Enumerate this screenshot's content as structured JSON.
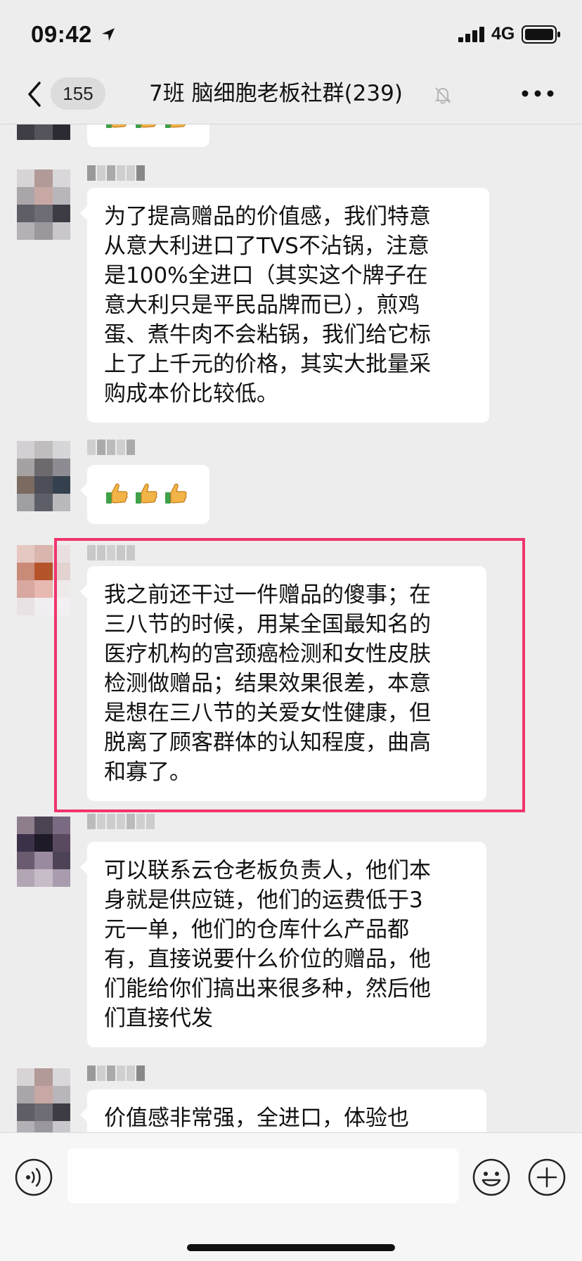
{
  "status_bar": {
    "time": "09:42",
    "network": "4G"
  },
  "nav": {
    "unread_count": "155",
    "title": "7班 脑细胞老板社群(239)"
  },
  "messages": [
    {
      "id": "m1",
      "type": "emoji",
      "emoji": [
        "thumbs-up",
        "thumbs-up",
        "thumbs-up"
      ]
    },
    {
      "id": "m2",
      "type": "text",
      "lines": [
        "为了提高赠品的价值感，我们特意",
        "从意大利进口了TVS不沾锅，注意",
        "是100%全进口（其实这个牌子在",
        "意大利只是平民品牌而已），煎鸡",
        "蛋、煮牛肉不会粘锅，我们给它标",
        "上了上千元的价格，其实大批量采",
        "购成本价比较低。"
      ]
    },
    {
      "id": "m3",
      "type": "emoji",
      "emoji": [
        "thumbs-up",
        "thumbs-up",
        "thumbs-up"
      ]
    },
    {
      "id": "m4",
      "type": "text",
      "highlighted": true,
      "lines": [
        "我之前还干过一件赠品的傻事；在",
        "三八节的时候，用某全国最知名的",
        "医疗机构的宫颈癌检测和女性皮肤",
        "检测做赠品；结果效果很差，本意",
        "是想在三八节的关爱女性健康，但",
        "脱离了顾客群体的认知程度，曲高",
        "和寡了。"
      ]
    },
    {
      "id": "m5",
      "type": "text",
      "lines": [
        "可以联系云仓老板负责人，他们本",
        "身就是供应链，他们的运费低于3",
        "元一单，他们的仓库什么产品都",
        "有，直接说要什么价位的赠品，他",
        "们能给你们搞出来很多种，然后他",
        "们直接代发"
      ]
    },
    {
      "id": "m6",
      "type": "text",
      "lines": [
        "价值感非常强，全进口，体验也"
      ]
    }
  ],
  "input": {
    "value": "",
    "placeholder": ""
  },
  "colors": {
    "highlight_border": "#f0356c",
    "background": "#ededed",
    "bubble": "#ffffff"
  }
}
